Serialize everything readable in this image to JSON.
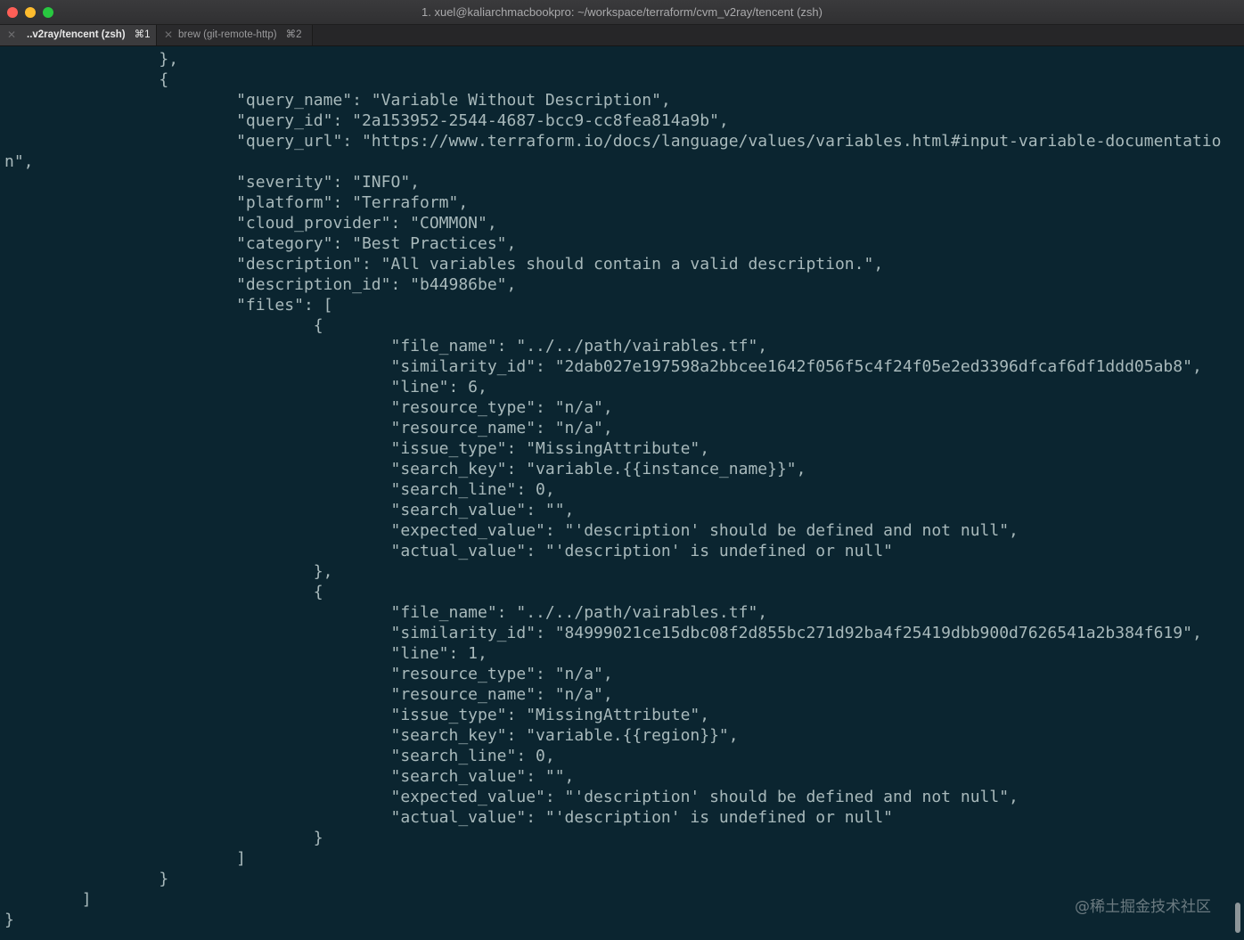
{
  "window": {
    "title": "1. xuel@kaliarchmacbookpro: ~/workspace/terraform/cvm_v2ray/tencent (zsh)"
  },
  "tabs": [
    {
      "label": "..v2ray/tencent (zsh)",
      "shortcut": "⌘1",
      "close": "✕"
    },
    {
      "label": "brew (git-remote-http)",
      "shortcut": "⌘2",
      "close": "✕"
    }
  ],
  "terminal": {
    "lines": [
      "                },",
      "                {",
      "                        \"query_name\": \"Variable Without Description\",",
      "                        \"query_id\": \"2a153952-2544-4687-bcc9-cc8fea814a9b\",",
      "                        \"query_url\": \"https://www.terraform.io/docs/language/values/variables.html#input-variable-documentatio",
      "n\",",
      "                        \"severity\": \"INFO\",",
      "                        \"platform\": \"Terraform\",",
      "                        \"cloud_provider\": \"COMMON\",",
      "                        \"category\": \"Best Practices\",",
      "                        \"description\": \"All variables should contain a valid description.\",",
      "                        \"description_id\": \"b44986be\",",
      "                        \"files\": [",
      "                                {",
      "                                        \"file_name\": \"../../path/vairables.tf\",",
      "                                        \"similarity_id\": \"2dab027e197598a2bbcee1642f056f5c4f24f05e2ed3396dfcaf6df1ddd05ab8\",",
      "                                        \"line\": 6,",
      "                                        \"resource_type\": \"n/a\",",
      "                                        \"resource_name\": \"n/a\",",
      "                                        \"issue_type\": \"MissingAttribute\",",
      "                                        \"search_key\": \"variable.{{instance_name}}\",",
      "                                        \"search_line\": 0,",
      "                                        \"search_value\": \"\",",
      "                                        \"expected_value\": \"'description' should be defined and not null\",",
      "                                        \"actual_value\": \"'description' is undefined or null\"",
      "                                },",
      "                                {",
      "                                        \"file_name\": \"../../path/vairables.tf\",",
      "                                        \"similarity_id\": \"84999021ce15dbc08f2d855bc271d92ba4f25419dbb900d7626541a2b384f619\",",
      "                                        \"line\": 1,",
      "                                        \"resource_type\": \"n/a\",",
      "                                        \"resource_name\": \"n/a\",",
      "                                        \"issue_type\": \"MissingAttribute\",",
      "                                        \"search_key\": \"variable.{{region}}\",",
      "                                        \"search_line\": 0,",
      "                                        \"search_value\": \"\",",
      "                                        \"expected_value\": \"'description' should be defined and not null\",",
      "                                        \"actual_value\": \"'description' is undefined or null\"",
      "                                }",
      "                        ]",
      "                }",
      "        ]",
      "}"
    ]
  },
  "watermark": "@稀土掘金技术社区"
}
